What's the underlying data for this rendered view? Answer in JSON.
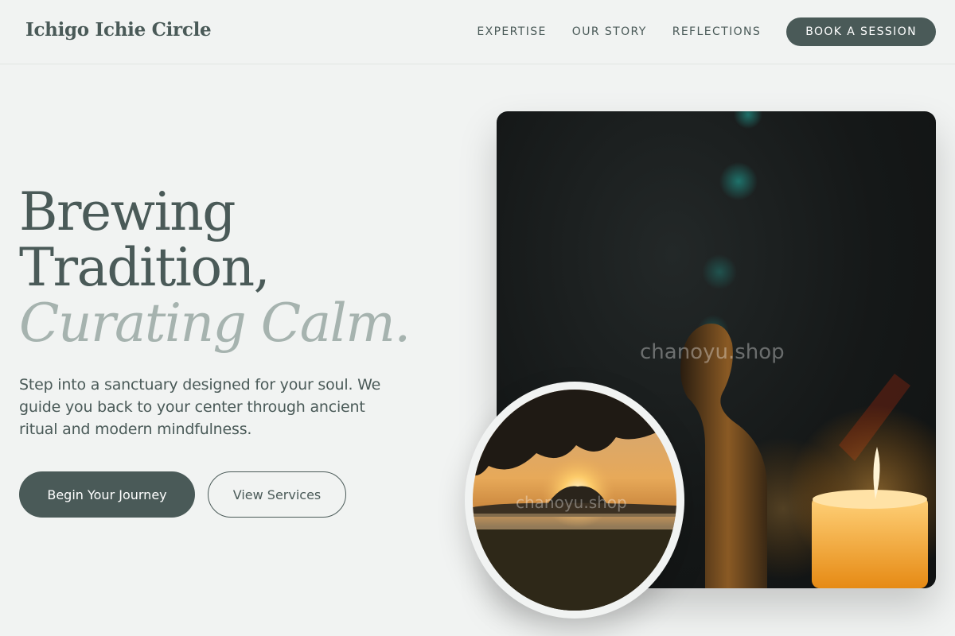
{
  "brand": {
    "name": "Ichigo Ichie Circle"
  },
  "nav": {
    "links": [
      "EXPERTISE",
      "OUR STORY",
      "REFLECTIONS"
    ],
    "cta": "BOOK A SESSION"
  },
  "hero": {
    "title_line1": "Brewing",
    "title_line2": "Tradition,",
    "title_accent": "Curating Calm.",
    "description": "Step into a sanctuary designed for your soul. We guide you back to your center through ancient ritual and modern mindfulness.",
    "primary_button": "Begin Your Journey",
    "secondary_button": "View Services"
  },
  "images": {
    "main_watermark": "chanoyu.shop",
    "circle_watermark": "chanoyu.shop"
  },
  "colors": {
    "primary": "#4a5a58",
    "accent_text": "#a6b3af",
    "background": "#f1f3f2"
  }
}
